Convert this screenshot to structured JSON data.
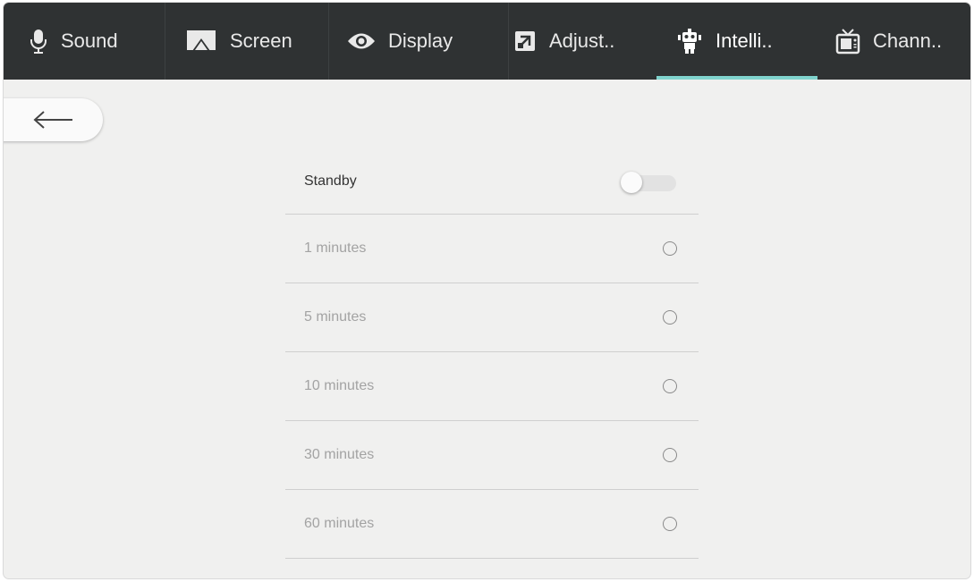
{
  "tabs": [
    {
      "label": "Sound",
      "icon": "microphone-icon",
      "active": false
    },
    {
      "label": "Screen",
      "icon": "cast-screen-icon",
      "active": false
    },
    {
      "label": "Display",
      "icon": "eye-icon",
      "active": false
    },
    {
      "label": "Adjust..",
      "icon": "adjust-icon",
      "active": false
    },
    {
      "label": "Intelli..",
      "icon": "robot-icon",
      "active": true
    },
    {
      "label": "Chann..",
      "icon": "tv-icon",
      "active": false
    }
  ],
  "back_button": {
    "icon": "arrow-left-icon"
  },
  "standby": {
    "label": "Standby",
    "enabled": false
  },
  "options": [
    {
      "label": "1 minutes",
      "selected": false
    },
    {
      "label": "5 minutes",
      "selected": false
    },
    {
      "label": "10 minutes",
      "selected": false
    },
    {
      "label": "30 minutes",
      "selected": false
    },
    {
      "label": "60 minutes",
      "selected": false
    }
  ],
  "colors": {
    "accent": "#7fd3cd",
    "tabbar": "#2f3233",
    "background": "#f0f0ef"
  }
}
